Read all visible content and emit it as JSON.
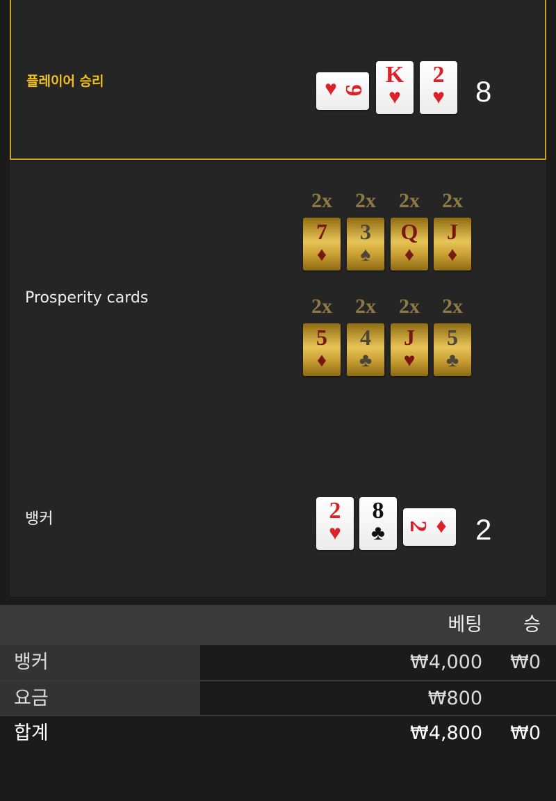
{
  "player": {
    "label": "플레이어 승리",
    "score": "8",
    "cards": [
      {
        "rank": "9",
        "suit": "♥",
        "color": "red",
        "orientation": "sideways"
      },
      {
        "rank": "K",
        "suit": "♥",
        "color": "red"
      },
      {
        "rank": "2",
        "suit": "♥",
        "color": "red"
      }
    ]
  },
  "prosperity": {
    "label": "Prosperity cards",
    "rows": [
      [
        {
          "multiplier": "2x",
          "rank": "7",
          "suit": "♦"
        },
        {
          "multiplier": "2x",
          "rank": "3",
          "suit": "♠"
        },
        {
          "multiplier": "2x",
          "rank": "Q",
          "suit": "♦"
        },
        {
          "multiplier": "2x",
          "rank": "J",
          "suit": "♦"
        }
      ],
      [
        {
          "multiplier": "2x",
          "rank": "5",
          "suit": "♦"
        },
        {
          "multiplier": "2x",
          "rank": "4",
          "suit": "♣"
        },
        {
          "multiplier": "2x",
          "rank": "J",
          "suit": "♥"
        },
        {
          "multiplier": "2x",
          "rank": "5",
          "suit": "♣"
        }
      ]
    ]
  },
  "banker": {
    "label": "뱅커",
    "score": "2",
    "cards": [
      {
        "rank": "2",
        "suit": "♥",
        "color": "red"
      },
      {
        "rank": "8",
        "suit": "♣",
        "color": "black"
      },
      {
        "rank": "2",
        "suit": "♦",
        "color": "red",
        "orientation": "sideways"
      }
    ]
  },
  "bets": {
    "header": {
      "bet": "베팅",
      "win": "승"
    },
    "rows": [
      {
        "label": "뱅커",
        "bet": "₩4,000",
        "win": "₩0"
      },
      {
        "label": "요금",
        "bet": "₩800",
        "win": ""
      }
    ],
    "total": {
      "label": "합계",
      "bet": "₩4,800",
      "win": "₩0"
    }
  },
  "colors": {
    "highlight": "#c9a42b",
    "player_label": "#f2c21b",
    "card_red": "#d9222a"
  }
}
